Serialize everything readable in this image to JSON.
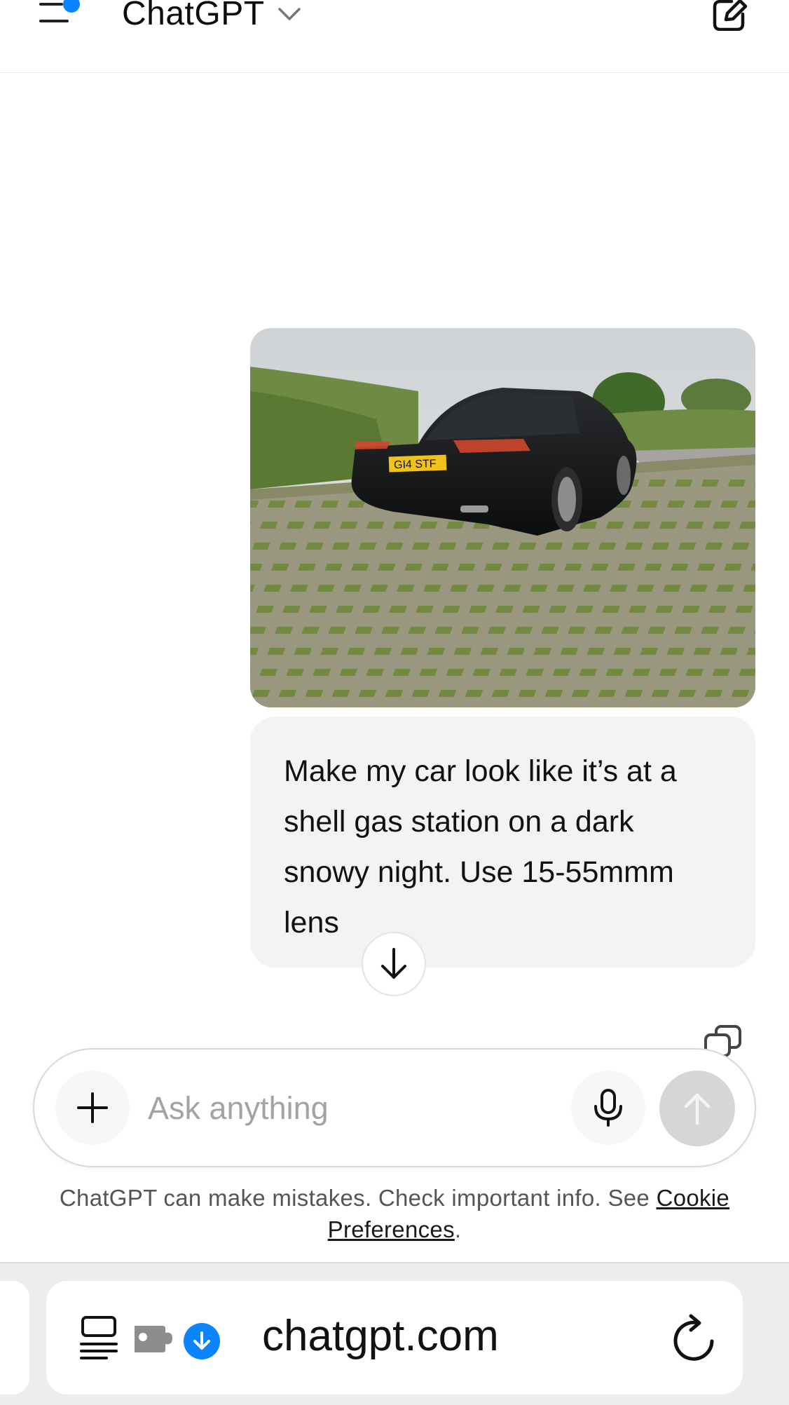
{
  "header": {
    "title": "ChatGPT",
    "accent": "#0a84ff"
  },
  "conversation": {
    "image_alt": "Photo of a black Audi sedan parked on grass-paved lot",
    "plate_text": "GI4 STF",
    "user_message": "Make my car look like it’s at a shell gas station on a dark snowy night. Use 15-55mmm lens"
  },
  "composer": {
    "placeholder": "Ask anything"
  },
  "disclaimer": {
    "text": "ChatGPT can make mistakes. Check important info. See ",
    "link": "Cookie Preferences",
    "end": "."
  },
  "browser": {
    "url": "chatgpt.com",
    "download_color": "#0a84ff"
  },
  "icons": [
    "menu-icon",
    "chevron-down-icon",
    "new-chat-icon",
    "arrow-down-icon",
    "copy-icon",
    "plus-icon",
    "mic-icon",
    "send-arrow-icon",
    "reader-icon",
    "extension-icon",
    "download-icon",
    "reload-icon"
  ]
}
